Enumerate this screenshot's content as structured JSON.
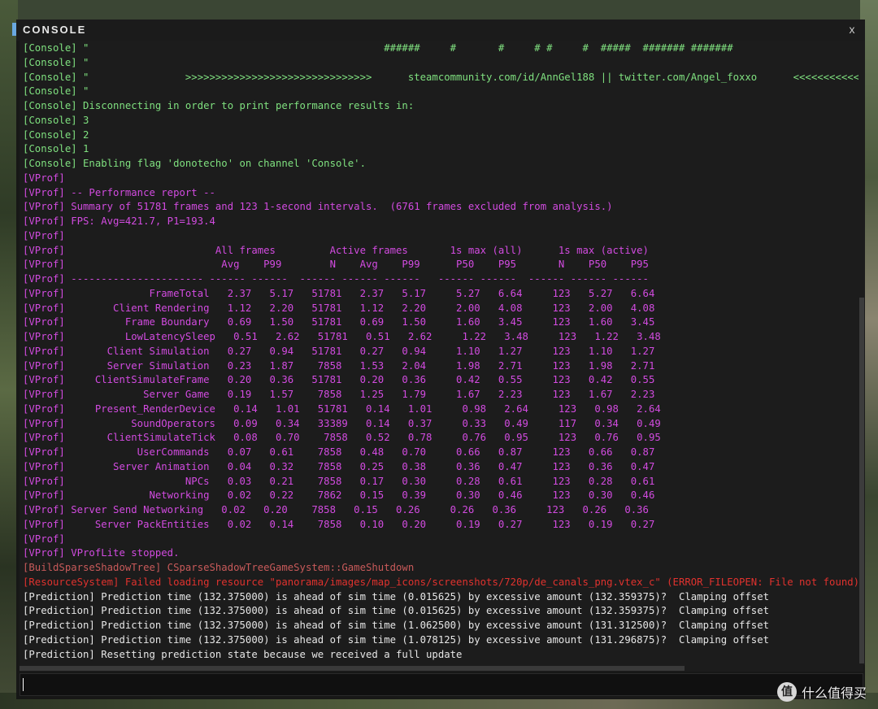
{
  "window": {
    "title": "CONSOLE",
    "close_label": "x"
  },
  "log": [
    {
      "c": "console",
      "t": "[Console] \"                                                 ######     #       #     # #     #  #####  ####### #######"
    },
    {
      "c": "console",
      "t": "[Console] \""
    },
    {
      "c": "console",
      "t": "[Console] \"                >>>>>>>>>>>>>>>>>>>>>>>>>>>>>>>      steamcommunity.com/id/AnnGel188 || twitter.com/Angel_foxxo      <<<<<<<<<<<<<<<<<<<<<<<<<<<<<<"
    },
    {
      "c": "console",
      "t": "[Console] \""
    },
    {
      "c": "console",
      "t": "[Console] Disconnecting in order to print performance results in:"
    },
    {
      "c": "console",
      "t": "[Console] 3"
    },
    {
      "c": "console",
      "t": "[Console] 2"
    },
    {
      "c": "console",
      "t": "[Console] 1"
    },
    {
      "c": "console",
      "t": "[Console] Enabling flag 'donotecho' on channel 'Console'."
    },
    {
      "c": "vprof",
      "t": "[VProf]"
    },
    {
      "c": "vprof",
      "t": "[VProf] -- Performance report --"
    },
    {
      "c": "vprof",
      "t": "[VProf] Summary of 51781 frames and 123 1-second intervals.  (6761 frames excluded from analysis.)"
    },
    {
      "c": "vprof",
      "t": "[VProf] FPS: Avg=421.7, P1=193.4"
    },
    {
      "c": "vprof",
      "t": "[VProf]"
    },
    {
      "c": "vprof",
      "t": "[VProf]                         All frames         Active frames       1s max (all)      1s max (active)"
    },
    {
      "c": "vprof",
      "t": "[VProf]                          Avg    P99        N    Avg    P99      P50    P95       N    P50    P95"
    },
    {
      "c": "vprof",
      "t": "[VProf] ---------------------- ------ ------  ------ ------ ------   ------ ------  ------ ------ ------"
    },
    {
      "c": "vprof",
      "t": "[VProf]              FrameTotal   2.37   5.17   51781   2.37   5.17     5.27   6.64     123   5.27   6.64"
    },
    {
      "c": "vprof",
      "t": "[VProf]        Client Rendering   1.12   2.20   51781   1.12   2.20     2.00   4.08     123   2.00   4.08"
    },
    {
      "c": "vprof",
      "t": "[VProf]          Frame Boundary   0.69   1.50   51781   0.69   1.50     1.60   3.45     123   1.60   3.45"
    },
    {
      "c": "vprof",
      "t": "[VProf]          LowLatencySleep   0.51   2.62   51781   0.51   2.62     1.22   3.48     123   1.22   3.48"
    },
    {
      "c": "vprof",
      "t": "[VProf]       Client Simulation   0.27   0.94   51781   0.27   0.94     1.10   1.27     123   1.10   1.27"
    },
    {
      "c": "vprof",
      "t": "[VProf]       Server Simulation   0.23   1.87    7858   1.53   2.04     1.98   2.71     123   1.98   2.71"
    },
    {
      "c": "vprof",
      "t": "[VProf]     ClientSimulateFrame   0.20   0.36   51781   0.20   0.36     0.42   0.55     123   0.42   0.55"
    },
    {
      "c": "vprof",
      "t": "[VProf]             Server Game   0.19   1.57    7858   1.25   1.79     1.67   2.23     123   1.67   2.23"
    },
    {
      "c": "vprof",
      "t": "[VProf]     Present_RenderDevice   0.14   1.01   51781   0.14   1.01     0.98   2.64     123   0.98   2.64"
    },
    {
      "c": "vprof",
      "t": "[VProf]           SoundOperators   0.09   0.34   33389   0.14   0.37     0.33   0.49     117   0.34   0.49"
    },
    {
      "c": "vprof",
      "t": "[VProf]       ClientSimulateTick   0.08   0.70    7858   0.52   0.78     0.76   0.95     123   0.76   0.95"
    },
    {
      "c": "vprof",
      "t": "[VProf]            UserCommands   0.07   0.61    7858   0.48   0.70     0.66   0.87     123   0.66   0.87"
    },
    {
      "c": "vprof",
      "t": "[VProf]        Server Animation   0.04   0.32    7858   0.25   0.38     0.36   0.47     123   0.36   0.47"
    },
    {
      "c": "vprof",
      "t": "[VProf]                    NPCs   0.03   0.21    7858   0.17   0.30     0.28   0.61     123   0.28   0.61"
    },
    {
      "c": "vprof",
      "t": "[VProf]              Networking   0.02   0.22    7862   0.15   0.39     0.30   0.46     123   0.30   0.46"
    },
    {
      "c": "vprof",
      "t": "[VProf] Server Send Networking   0.02   0.20    7858   0.15   0.26     0.26   0.36     123   0.26   0.36"
    },
    {
      "c": "vprof",
      "t": "[VProf]     Server PackEntities   0.02   0.14    7858   0.10   0.20     0.19   0.27     123   0.19   0.27"
    },
    {
      "c": "vprof",
      "t": "[VProf]"
    },
    {
      "c": "vprof",
      "t": "[VProf] VProfLite stopped."
    },
    {
      "c": "build",
      "t": "[BuildSparseShadowTree] CSparseShadowTreeGameSystem::GameShutdown"
    },
    {
      "c": "error",
      "t": "[ResourceSystem] Failed loading resource \"panorama/images/map_icons/screenshots/720p/de_canals_png.vtex_c\" (ERROR_FILEOPEN: File not found)"
    },
    {
      "c": "pred",
      "t": "[Prediction] Prediction time (132.375000) is ahead of sim time (0.015625) by excessive amount (132.359375)?  Clamping offset"
    },
    {
      "c": "pred",
      "t": "[Prediction] Prediction time (132.375000) is ahead of sim time (0.015625) by excessive amount (132.359375)?  Clamping offset"
    },
    {
      "c": "pred",
      "t": "[Prediction] Prediction time (132.375000) is ahead of sim time (1.062500) by excessive amount (131.312500)?  Clamping offset"
    },
    {
      "c": "pred",
      "t": "[Prediction] Prediction time (132.375000) is ahead of sim time (1.078125) by excessive amount (131.296875)?  Clamping offset"
    },
    {
      "c": "pred",
      "t": "[Prediction] Resetting prediction state because we received a full update"
    }
  ],
  "input": {
    "value": ""
  },
  "watermark": {
    "logo": "值",
    "text": "什么值得买"
  },
  "colors": {
    "console": "#7fe07f",
    "vprof": "#d24be0",
    "build": "#c85a5a",
    "error": "#e0322e",
    "prediction": "#e6e6e6"
  }
}
